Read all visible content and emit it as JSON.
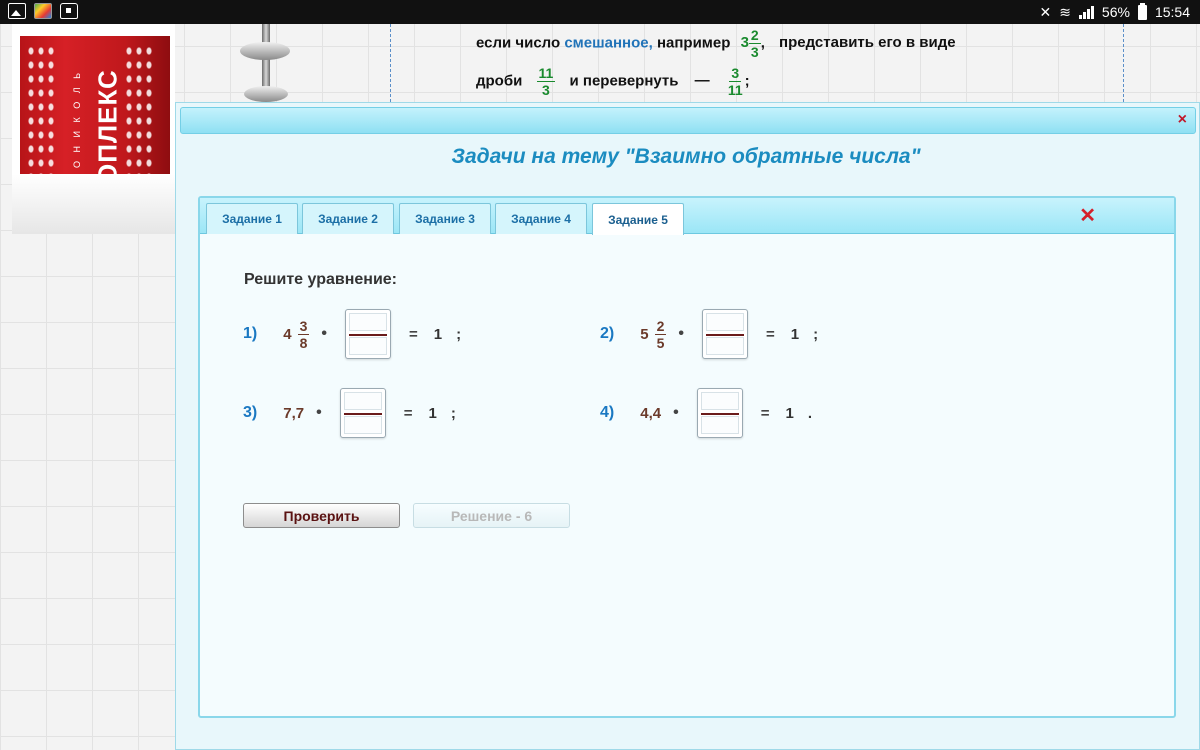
{
  "status_bar": {
    "battery": "56%",
    "time": "15:54"
  },
  "background": {
    "product_brand": "ОПЛЕКС",
    "product_sub": "О Н И К О Л Ь",
    "line1": {
      "prefix": "если число",
      "highlight": "смешанное,",
      "mid": "например",
      "whole": "3",
      "num": "2",
      "den": "3",
      "comma": ",",
      "suffix": "представить его в виде"
    },
    "line2": {
      "prefix": "дроби",
      "num1": "11",
      "den1": "3",
      "mid": "и перевернуть",
      "dash": "—",
      "num2": "3",
      "den2": "11",
      "semicolon": ";"
    }
  },
  "modal": {
    "close_icon": "×",
    "title": "Задачи на тему \"Взаимно обратные числа\""
  },
  "tabs": [
    {
      "label": "Задание 1",
      "active": false
    },
    {
      "label": "Задание 2",
      "active": false
    },
    {
      "label": "Задание 3",
      "active": false
    },
    {
      "label": "Задание 4",
      "active": false
    },
    {
      "label": "Задание 5",
      "active": true
    }
  ],
  "panel": {
    "close_icon": "✕",
    "heading": "Решите уравнение:",
    "equations": [
      {
        "number": "1)",
        "whole": "4",
        "num": "3",
        "den": "8",
        "dot": "•",
        "equals": "=",
        "rhs": "1",
        "end": ";"
      },
      {
        "number": "2)",
        "whole": "5",
        "num": "2",
        "den": "5",
        "dot": "•",
        "equals": "=",
        "rhs": "1",
        "end": ";"
      },
      {
        "number": "3)",
        "value": "7,7",
        "dot": "•",
        "equals": "=",
        "rhs": "1",
        "end": ";"
      },
      {
        "number": "4)",
        "value": "4,4",
        "dot": "•",
        "equals": "=",
        "rhs": "1",
        "end": "."
      }
    ],
    "check_button": "Проверить",
    "solution_button": "Решение - 6"
  }
}
